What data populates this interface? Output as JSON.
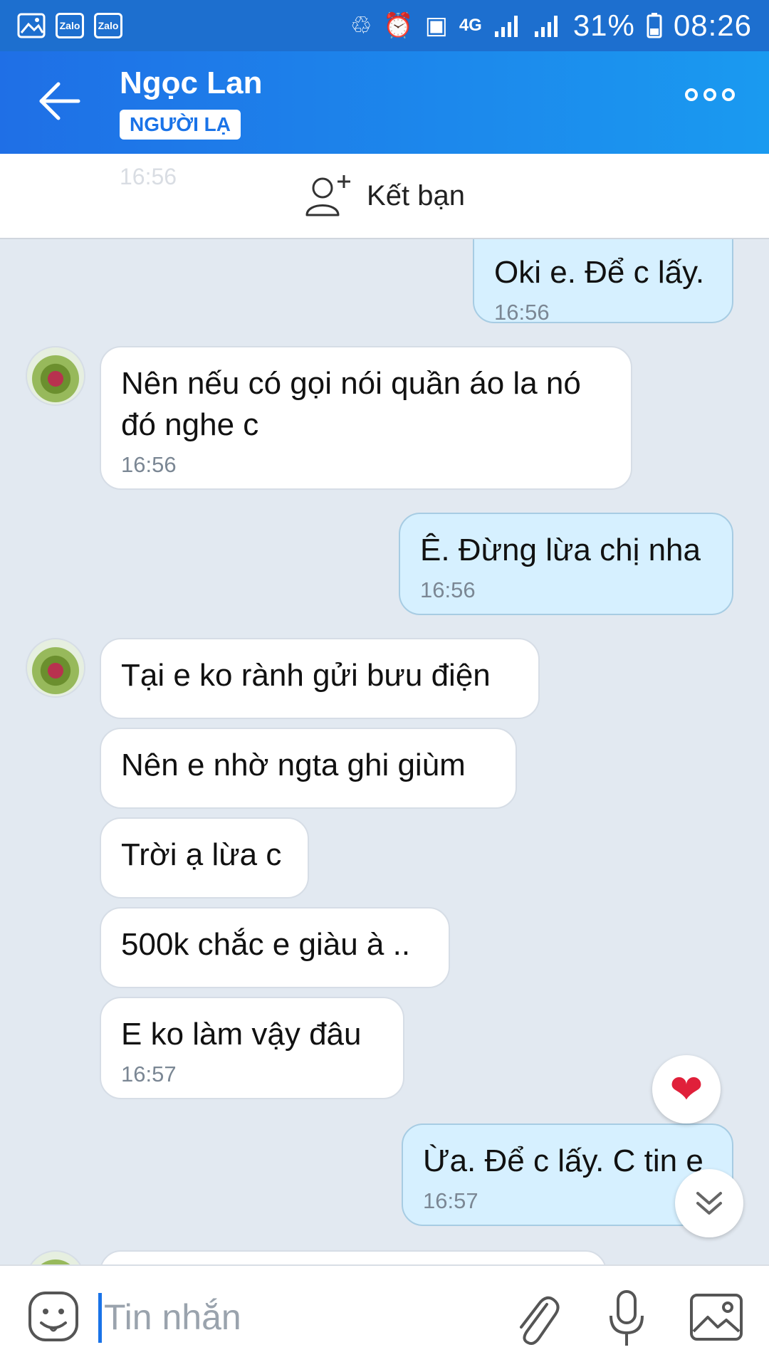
{
  "status_bar": {
    "left_icons": [
      "image-icon",
      "Zalo",
      "Zalo"
    ],
    "network": "4G",
    "battery": "31%",
    "time": "08:26"
  },
  "header": {
    "contact_name": "Ngọc Lan",
    "badge": "NGƯỜI LẠ"
  },
  "add_friend": {
    "label": "Kết bạn",
    "ghost_time": "16:56"
  },
  "messages": [
    {
      "side": "sent",
      "text": "Oki e. Để c lấy.",
      "time": "16:56"
    },
    {
      "side": "recv",
      "text": "Nên nếu có gọi nói quần áo la nó đó nghe c",
      "time": "16:56"
    },
    {
      "side": "sent",
      "text": "Ê. Đừng lừa chị nha",
      "time": "16:56"
    },
    {
      "side": "recv",
      "text": "Tại e ko rành gửi bưu điện",
      "time": ""
    },
    {
      "side": "recv",
      "text": "Nên e nhờ ngta ghi giùm",
      "time": ""
    },
    {
      "side": "recv",
      "text": "Trời ạ lừa c",
      "time": ""
    },
    {
      "side": "recv",
      "text": "500k chắc e giàu à ..",
      "time": ""
    },
    {
      "side": "recv",
      "text": "E ko làm vậy đâu",
      "time": "16:57"
    },
    {
      "side": "sent",
      "text": "Ừa. Để c lấy. C tin e",
      "time": "16:57"
    }
  ],
  "input": {
    "placeholder": "Tin nhắn"
  },
  "colors": {
    "header_start": "#1f6fe6",
    "header_end": "#1a9af0",
    "sent_bubble": "#d6f0ff",
    "recv_bubble": "#ffffff",
    "chat_bg": "#e2e9f1"
  }
}
